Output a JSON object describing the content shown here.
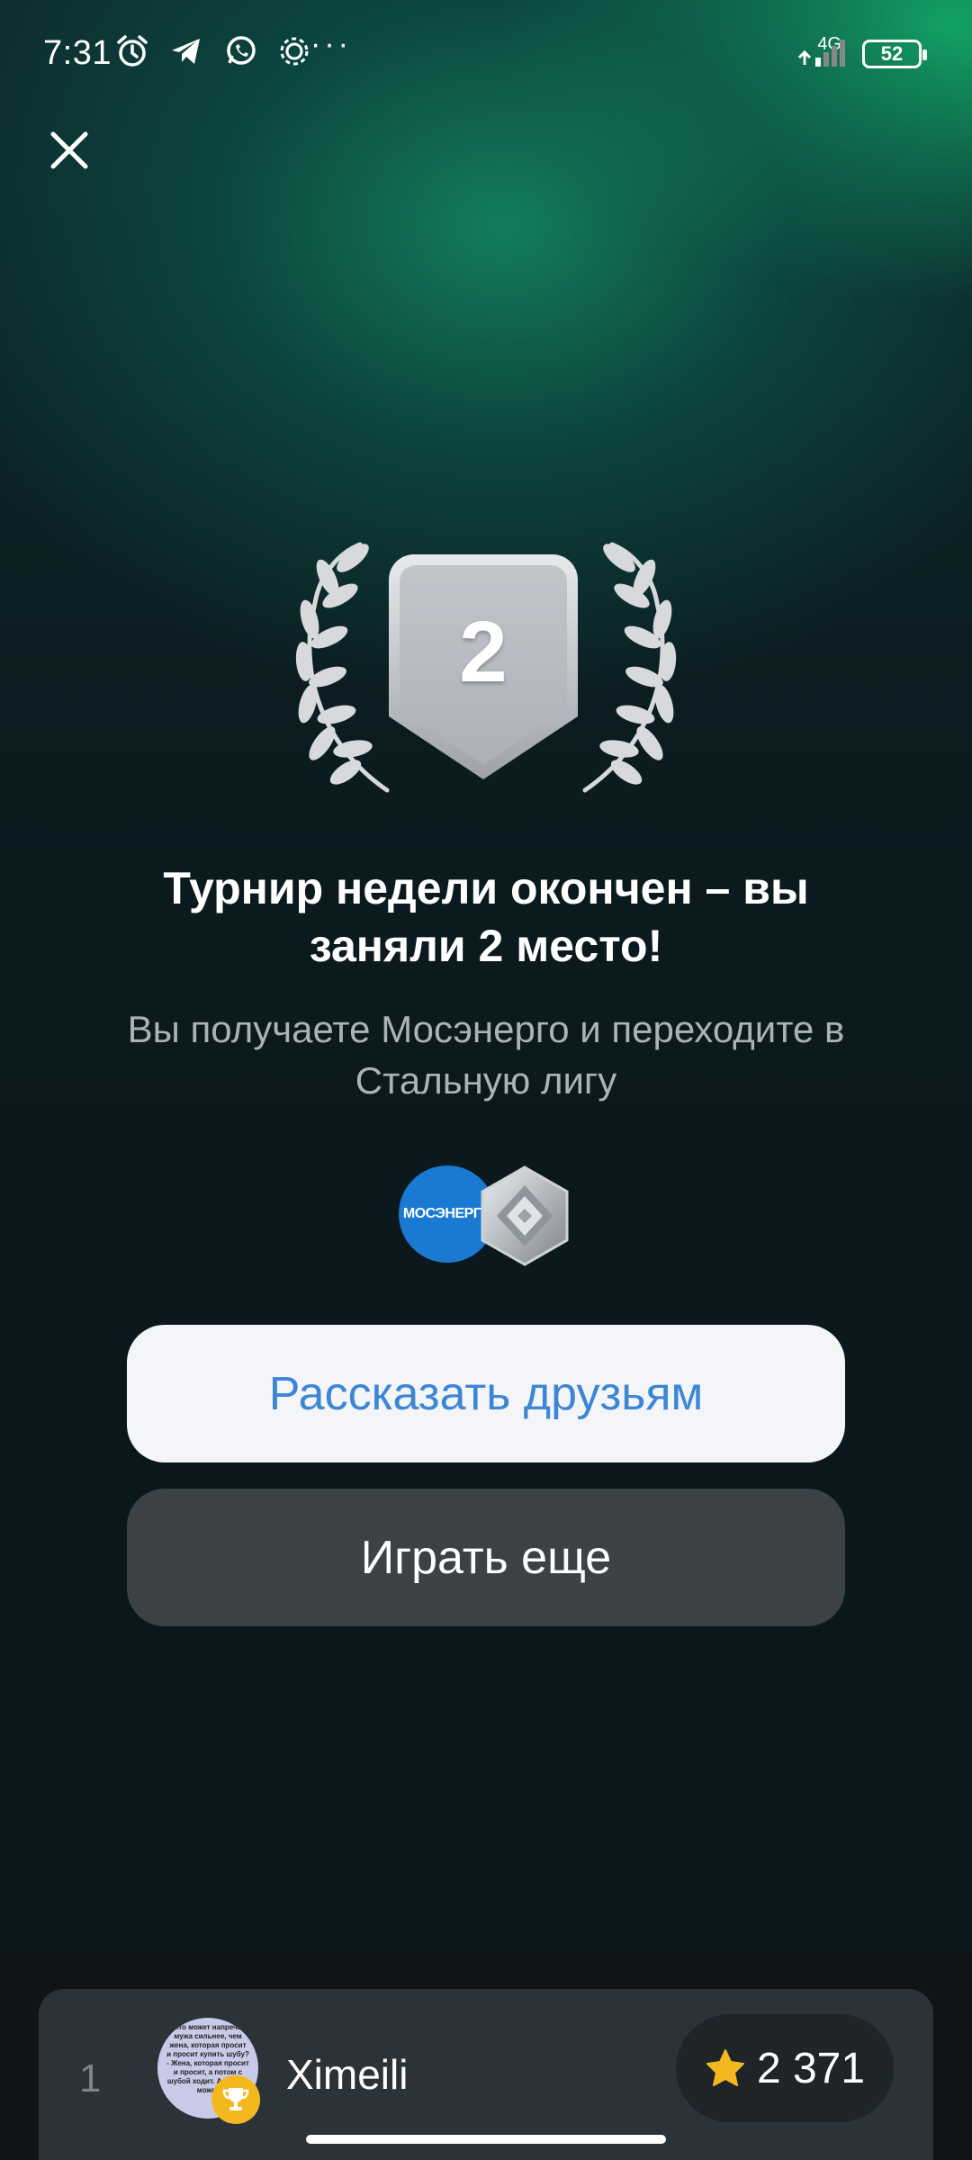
{
  "status_bar": {
    "time": "7:31",
    "network": "4G",
    "battery": "52",
    "icons": [
      "alarm-icon",
      "telegram-icon",
      "whatsapp-icon",
      "settings-icon",
      "more-dots-icon"
    ]
  },
  "close_icon": "close-icon",
  "badge": {
    "place": "2",
    "color": "#c9ccd2"
  },
  "result": {
    "headline": "Турнир недели окончен – вы заняли 2 место!",
    "subline": "Вы получаете Мосэнерго и переходите в Стальную лигу"
  },
  "rewards": {
    "company_logo_text": "МОСЭНЕРГО",
    "company_color": "#1a7ad1",
    "league_icon": "steel-league-icon"
  },
  "buttons": {
    "share": "Рассказать друзьям",
    "play_again": "Играть еще"
  },
  "leaderboard": {
    "rank": "1",
    "name": "Ximeili",
    "score": "2 371",
    "score_icon": "star-icon",
    "badge_icon": "trophy-icon",
    "avatar_text": "Кто может напречь мужа сильнее, чем жена, которая просит и просит купить шубу? - Жена, которая просит и просит, а потом с шубой ходит. А муж не может"
  },
  "colors": {
    "accent_blue": "#3d86d6",
    "gold": "#f4b81f",
    "green_glow": "#14be6e"
  }
}
